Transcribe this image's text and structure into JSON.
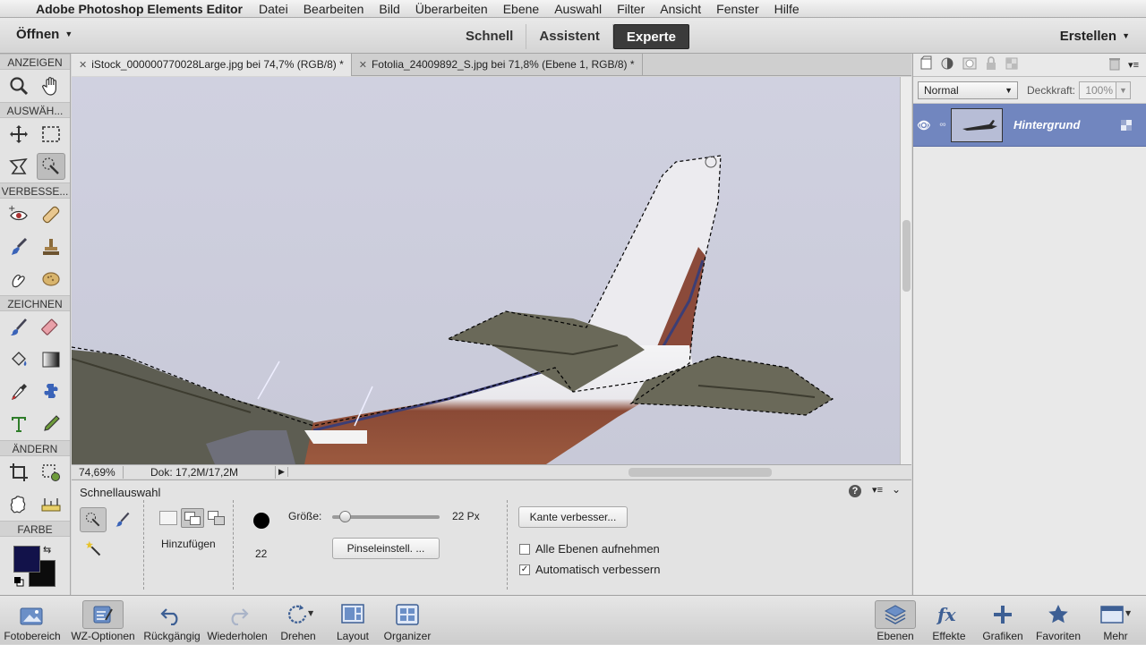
{
  "menubar": {
    "app_name": "Adobe Photoshop Elements Editor",
    "items": [
      "Datei",
      "Bearbeiten",
      "Bild",
      "Überarbeiten",
      "Ebene",
      "Auswahl",
      "Filter",
      "Ansicht",
      "Fenster",
      "Hilfe"
    ]
  },
  "topbar": {
    "open_label": "Öffnen",
    "modes": [
      "Schnell",
      "Assistent",
      "Experte"
    ],
    "active_mode": "Experte",
    "create_label": "Erstellen"
  },
  "toolbox": {
    "sections": {
      "view": "ANZEIGEN",
      "select": "AUSWÄH...",
      "enhance": "VERBESSE...",
      "draw": "ZEICHNEN",
      "modify": "ÄNDERN",
      "color": "FARBE"
    },
    "foreground_color": "#12124a",
    "background_color": "#0c0c0c"
  },
  "tabs": [
    {
      "label": "iStock_000000770028Large.jpg bei 74,7% (RGB/8) *",
      "active": true
    },
    {
      "label": "Fotolia_24009892_S.jpg bei 71,8% (Ebene 1, RGB/8) *",
      "active": false
    }
  ],
  "status": {
    "zoom": "74,69%",
    "doc": "Dok: 17,2M/17,2M"
  },
  "tool_options": {
    "title": "Schnellauswahl",
    "mode_label": "Hinzufügen",
    "brush_size_value": "22",
    "size_label": "Größe:",
    "size_value": "22 Px",
    "size_fraction": 0.12,
    "brush_settings_button": "Pinseleinstell. ...",
    "refine_edge_button": "Kante verbesser...",
    "sample_all_layers": {
      "label": "Alle Ebenen aufnehmen",
      "checked": false
    },
    "auto_enhance": {
      "label": "Automatisch verbessern",
      "checked": true
    }
  },
  "layers_panel": {
    "blend_mode": "Normal",
    "opacity_label": "Deckkraft:",
    "opacity_value": "100%",
    "layer_name": "Hintergrund"
  },
  "bottombar": {
    "left": [
      {
        "label": "Fotobereich",
        "icon": "photo-bin-icon"
      },
      {
        "label": "WZ-Optionen",
        "icon": "tool-options-icon",
        "selected": true
      },
      {
        "label": "Rückgängig",
        "icon": "undo-icon"
      },
      {
        "label": "Wiederholen",
        "icon": "redo-icon"
      },
      {
        "label": "Drehen",
        "icon": "rotate-icon"
      },
      {
        "label": "Layout",
        "icon": "layout-icon"
      },
      {
        "label": "Organizer",
        "icon": "organizer-icon"
      }
    ],
    "right": [
      {
        "label": "Ebenen",
        "icon": "layers-icon",
        "selected": true
      },
      {
        "label": "Effekte",
        "icon": "fx-icon"
      },
      {
        "label": "Grafiken",
        "icon": "plus-icon"
      },
      {
        "label": "Favoriten",
        "icon": "star-icon"
      },
      {
        "label": "Mehr",
        "icon": "more-icon"
      }
    ]
  }
}
